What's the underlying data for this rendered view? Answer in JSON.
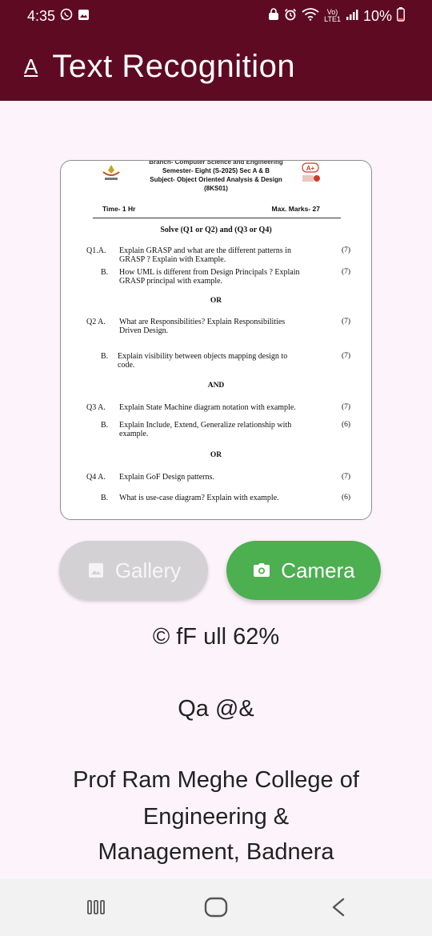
{
  "status_bar": {
    "time": "4:35",
    "lte_top": "Vo)",
    "lte_bottom": "LTE1",
    "battery": "10%"
  },
  "app_bar": {
    "title": "Text Recognition",
    "icon": "text-recognition-icon"
  },
  "document": {
    "header_lines": [
      "Branch- Computer Science and Engineering",
      "Semester- Eight (S-2025) Sec A & B",
      "Subject- Object Oriented Analysis & Design",
      "(8KS01)"
    ],
    "time": "Time- 1 Hr",
    "max_marks": "Max. Marks- 27",
    "instruction": "Solve (Q1 or Q2) and (Q3 or Q4)",
    "q1a_label": "Q1.A.",
    "q1a_line1": "Explain GRASP and what are the different patterns in",
    "q1a_line2": "GRASP ? Explain with Example.",
    "q1a_marks": "(7)",
    "q1b_label": "B.",
    "q1b_line1": "How UML is different from Design Principals ? Explain",
    "q1b_line2": "GRASP principal with example.",
    "q1b_marks": "(7)",
    "or1": "OR",
    "q2a_label": "Q2 A.",
    "q2a_line1": "What are Responsibilities? Explain Responsibilities",
    "q2a_line2": "Driven Design.",
    "q2a_marks": "(7)",
    "q2b_label": "B.",
    "q2b_line1": "Explain visibility between objects mapping design to",
    "q2b_line2": "code.",
    "q2b_marks": "(7)",
    "and": "AND",
    "q3a_label": "Q3 A.",
    "q3a_line1": "Explain State Machine diagram notation with example.",
    "q3a_marks": "(7)",
    "q3b_label": "B.",
    "q3b_line1": "Explain Include, Extend, Generalize relationship with",
    "q3b_line2": "example.",
    "q3b_marks": "(6)",
    "or2": "OR",
    "q4a_label": "Q4 A.",
    "q4a_line1": "Explain GoF Design patterns.",
    "q4a_marks": "(7)",
    "q4b_label": "B.",
    "q4b_line1": "What is use-case diagram? Explain with example.",
    "q4b_marks": "(6)"
  },
  "buttons": {
    "gallery_label": "Gallery",
    "camera_label": "Camera"
  },
  "recognized_text": {
    "line1": "© fF ull 62%",
    "line2": "Qa @&",
    "line3": "Prof Ram Meghe College of",
    "line4": "Engineering &",
    "line5": "Management, Badnera"
  },
  "colors": {
    "app_bar": "#5e0a22",
    "camera_button": "#4caf50",
    "gallery_button": "#d4d1d5",
    "background": "#fdf4fb"
  }
}
